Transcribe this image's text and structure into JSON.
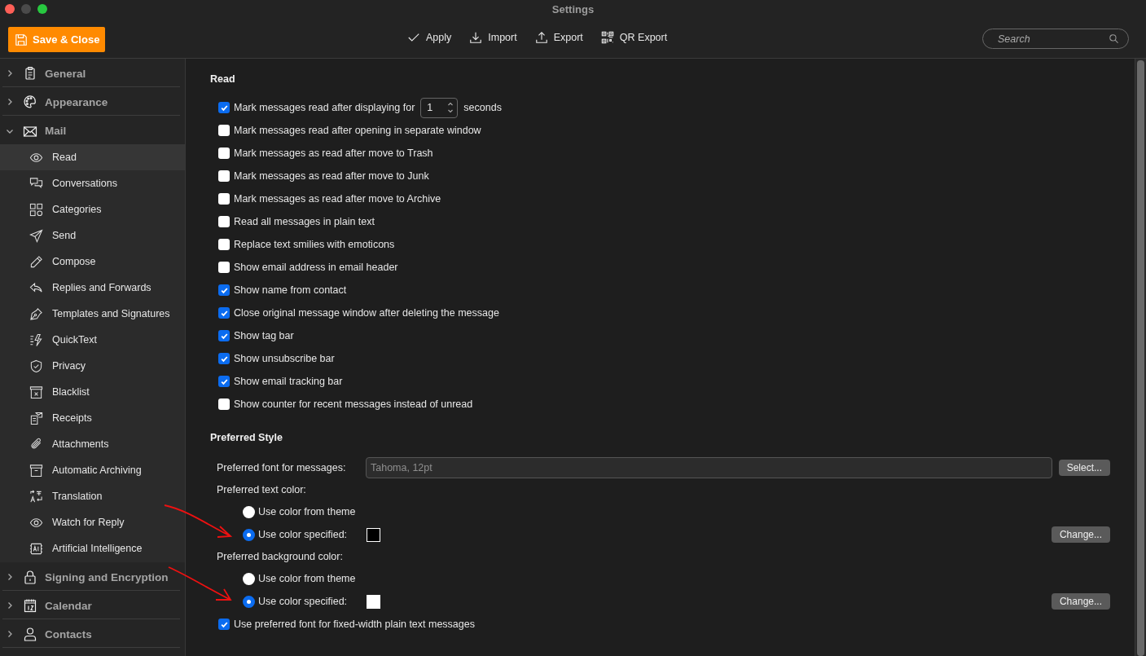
{
  "window": {
    "title": "Settings"
  },
  "toolbar": {
    "save_button": "Save & Close",
    "actions": [
      {
        "label": "Apply"
      },
      {
        "label": "Import"
      },
      {
        "label": "Export"
      },
      {
        "label": "QR Export"
      }
    ],
    "search": {
      "placeholder": "Search"
    }
  },
  "sidebar": {
    "groups": [
      {
        "label": "General",
        "expanded": false
      },
      {
        "label": "Appearance",
        "expanded": false
      },
      {
        "label": "Mail",
        "expanded": true,
        "children": [
          {
            "label": "Read",
            "selected": true
          },
          {
            "label": "Conversations",
            "selected": false
          },
          {
            "label": "Categories",
            "selected": false
          },
          {
            "label": "Send",
            "selected": false
          },
          {
            "label": "Compose",
            "selected": false
          },
          {
            "label": "Replies and Forwards",
            "selected": false
          },
          {
            "label": "Templates and Signatures",
            "selected": false
          },
          {
            "label": "QuickText",
            "selected": false
          },
          {
            "label": "Privacy",
            "selected": false
          },
          {
            "label": "Blacklist",
            "selected": false
          },
          {
            "label": "Receipts",
            "selected": false
          },
          {
            "label": "Attachments",
            "selected": false
          },
          {
            "label": "Automatic Archiving",
            "selected": false
          },
          {
            "label": "Translation",
            "selected": false
          },
          {
            "label": "Watch for Reply",
            "selected": false
          },
          {
            "label": "Artificial Intelligence",
            "selected": false
          }
        ]
      },
      {
        "label": "Signing and Encryption",
        "expanded": false
      },
      {
        "label": "Calendar",
        "expanded": false
      },
      {
        "label": "Contacts",
        "expanded": false
      }
    ]
  },
  "read_section": {
    "title": "Read",
    "options": [
      {
        "kind": "spinner",
        "label": "Mark messages read after displaying for",
        "checked": true,
        "value": "1",
        "suffix": "seconds"
      },
      {
        "kind": "plain",
        "label": "Mark messages read after opening in separate window",
        "checked": false
      },
      {
        "kind": "plain",
        "label": "Mark messages as read after move to Trash",
        "checked": false
      },
      {
        "kind": "plain",
        "label": "Mark messages as read after move to Junk",
        "checked": false
      },
      {
        "kind": "plain",
        "label": "Mark messages as read after move to Archive",
        "checked": false
      },
      {
        "kind": "plain",
        "label": "Read all messages in plain text",
        "checked": false
      },
      {
        "kind": "plain",
        "label": "Replace text smilies with emoticons",
        "checked": false
      },
      {
        "kind": "plain",
        "label": "Show email address in email header",
        "checked": false
      },
      {
        "kind": "plain",
        "label": "Show name from contact",
        "checked": true
      },
      {
        "kind": "plain",
        "label": "Close original message window after deleting the message",
        "checked": true
      },
      {
        "kind": "plain",
        "label": "Show tag bar",
        "checked": true
      },
      {
        "kind": "plain",
        "label": "Show unsubscribe bar",
        "checked": true
      },
      {
        "kind": "plain",
        "label": "Show email tracking bar",
        "checked": true
      },
      {
        "kind": "plain",
        "label": "Show counter for recent messages instead of unread",
        "checked": false
      }
    ]
  },
  "style_section": {
    "title": "Preferred Style",
    "font": {
      "label": "Preferred font for messages:",
      "value": "Tahoma, 12pt",
      "button": "Select..."
    },
    "color_groups": [
      {
        "label": "Preferred text color:",
        "button": "Change...",
        "options": [
          {
            "kind": "plain",
            "label": "Use color from theme",
            "selected": false
          },
          {
            "kind": "swatch",
            "label": "Use color specified:",
            "selected": true,
            "color": "#000000"
          }
        ]
      },
      {
        "label": "Preferred background color:",
        "button": "Change...",
        "options": [
          {
            "kind": "plain",
            "label": "Use color from theme",
            "selected": false
          },
          {
            "kind": "swatch",
            "label": "Use color specified:",
            "selected": true,
            "color": "#ffffff"
          }
        ]
      }
    ],
    "fixed_width": {
      "label": "Use preferred font for fixed-width plain text messages",
      "checked": true
    }
  }
}
